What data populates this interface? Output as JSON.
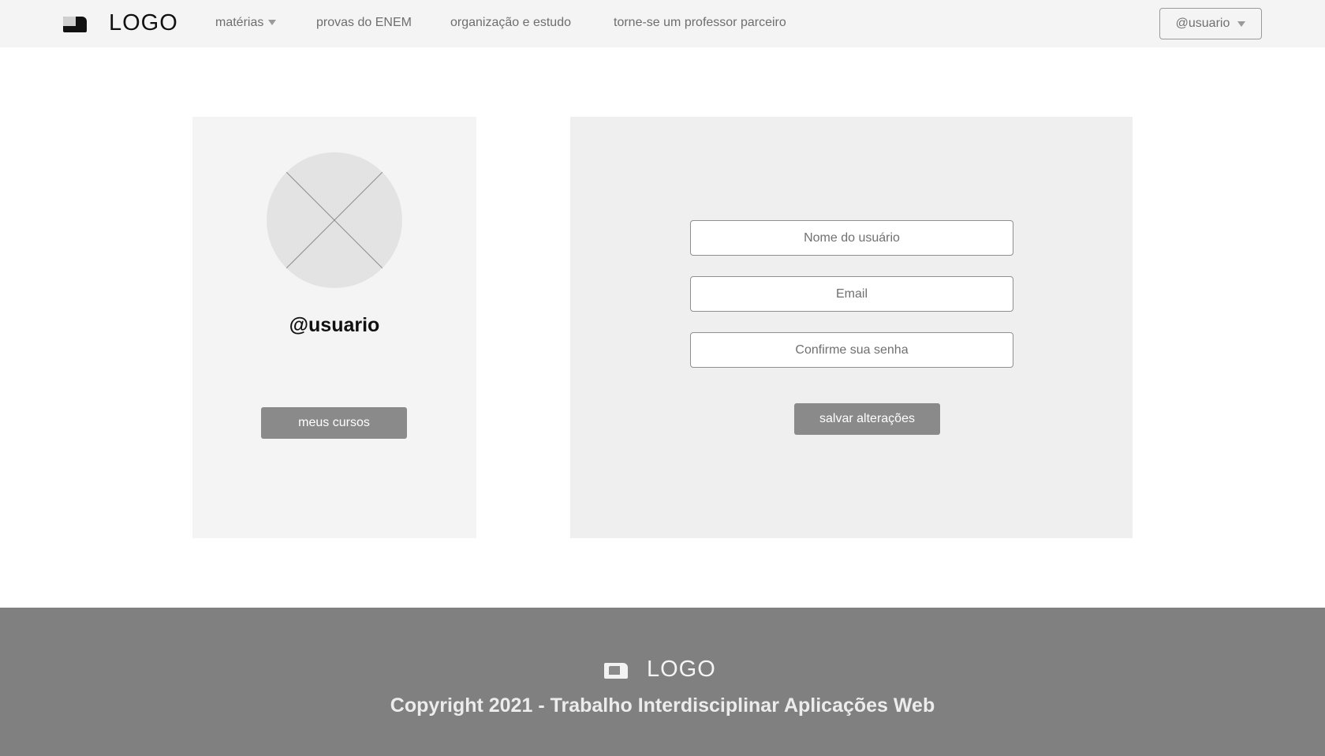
{
  "header": {
    "logo_text": "LOGO",
    "nav": {
      "materias": "matérias",
      "provas": "provas do ENEM",
      "organizacao": "organização e estudo",
      "parceiro": "torne-se um professor parceiro"
    },
    "user_menu": "@usuario"
  },
  "profile": {
    "username": "@usuario",
    "courses_button": "meus cursos"
  },
  "form": {
    "name_placeholder": "Nome do usuário",
    "email_placeholder": "Email",
    "password_placeholder": "Confirme sua senha",
    "save_button": "salvar alterações"
  },
  "footer": {
    "logo_text": "LOGO",
    "copyright": "Copyright 2021 - Trabalho Interdisciplinar Aplicações Web"
  }
}
